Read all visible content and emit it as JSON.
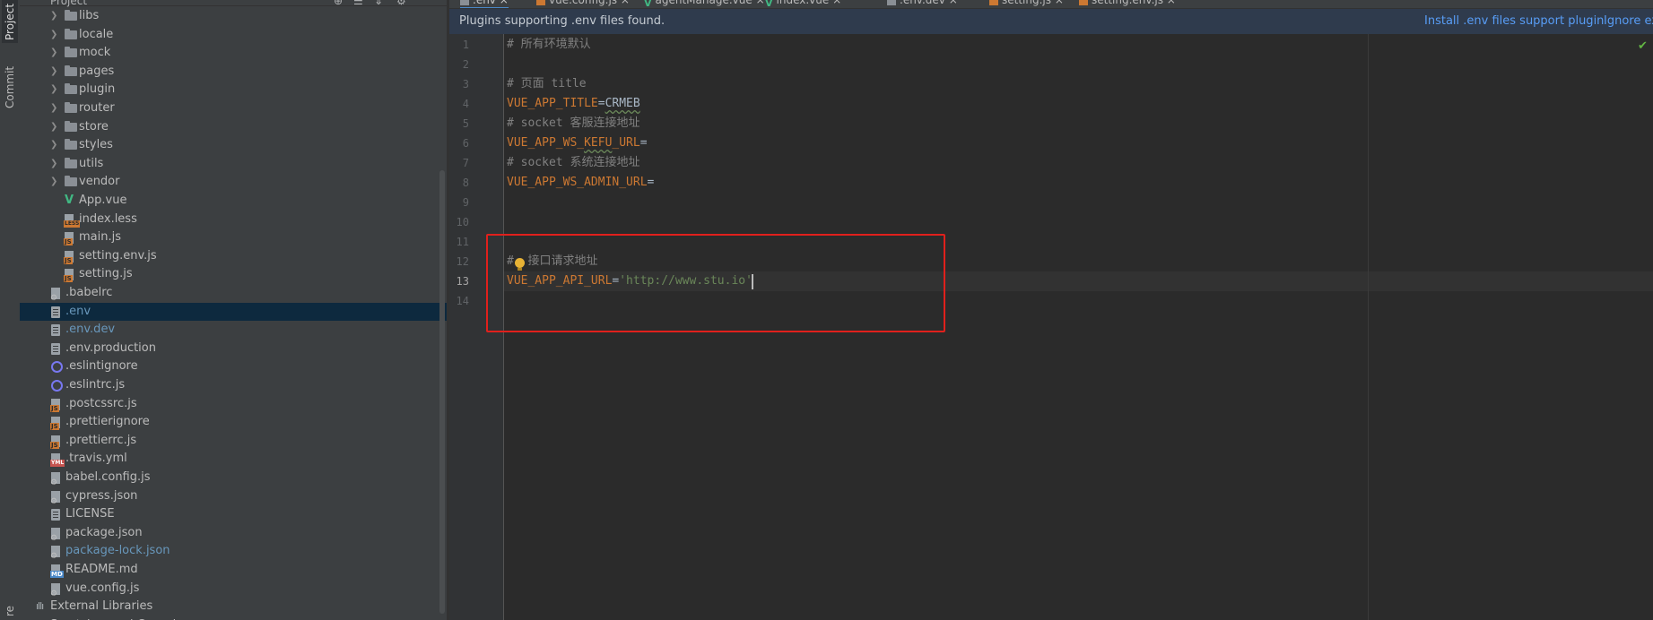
{
  "left_strip": {
    "project_tab": "Project",
    "commit_tab": "Commit",
    "bottom_tab": "re"
  },
  "project_panel": {
    "title": "Project",
    "tree": [
      {
        "label": "libs",
        "type": "folder",
        "depth": 1
      },
      {
        "label": "locale",
        "type": "folder",
        "depth": 1
      },
      {
        "label": "mock",
        "type": "folder",
        "depth": 1
      },
      {
        "label": "pages",
        "type": "folder",
        "depth": 1
      },
      {
        "label": "plugin",
        "type": "folder",
        "depth": 1
      },
      {
        "label": "router",
        "type": "folder",
        "depth": 1
      },
      {
        "label": "store",
        "type": "folder",
        "depth": 1
      },
      {
        "label": "styles",
        "type": "folder",
        "depth": 1
      },
      {
        "label": "utils",
        "type": "folder",
        "depth": 1
      },
      {
        "label": "vendor",
        "type": "folder",
        "depth": 1
      },
      {
        "label": "App.vue",
        "type": "vue",
        "depth": 1
      },
      {
        "label": "index.less",
        "type": "less",
        "depth": 1
      },
      {
        "label": "main.js",
        "type": "js",
        "depth": 1
      },
      {
        "label": "setting.env.js",
        "type": "js",
        "depth": 1
      },
      {
        "label": "setting.js",
        "type": "js",
        "depth": 1
      },
      {
        "label": ".babelrc",
        "type": "gear",
        "depth": 0
      },
      {
        "label": ".env",
        "type": "file",
        "depth": 0,
        "selected": true,
        "new": true
      },
      {
        "label": ".env.dev",
        "type": "file",
        "depth": 0,
        "new": true
      },
      {
        "label": ".env.production",
        "type": "file",
        "depth": 0
      },
      {
        "label": ".eslintignore",
        "type": "ring",
        "depth": 0
      },
      {
        "label": ".eslintrc.js",
        "type": "ring",
        "depth": 0
      },
      {
        "label": ".postcssrc.js",
        "type": "js",
        "depth": 0
      },
      {
        "label": ".prettierignore",
        "type": "js",
        "depth": 0
      },
      {
        "label": ".prettierrc.js",
        "type": "js",
        "depth": 0
      },
      {
        "label": ".travis.yml",
        "type": "yml",
        "depth": 0
      },
      {
        "label": "babel.config.js",
        "type": "gear",
        "depth": 0
      },
      {
        "label": "cypress.json",
        "type": "gear",
        "depth": 0
      },
      {
        "label": "LICENSE",
        "type": "file",
        "depth": 0
      },
      {
        "label": "package.json",
        "type": "gear",
        "depth": 0
      },
      {
        "label": "package-lock.json",
        "type": "gear",
        "depth": 0,
        "new": true
      },
      {
        "label": "README.md",
        "type": "md",
        "depth": 0
      },
      {
        "label": "vue.config.js",
        "type": "gear",
        "depth": 0
      },
      {
        "label": "External Libraries",
        "type": "lib",
        "depth": -1
      },
      {
        "label": "Scratches and Consoles",
        "type": "scratch",
        "depth": -1
      }
    ]
  },
  "tabs": [
    {
      "label": ".env",
      "type": "env",
      "active": true
    },
    {
      "label": "vue.config.js",
      "type": "js"
    },
    {
      "label": "agentManage.vue",
      "type": "vue"
    },
    {
      "label": "index.vue",
      "type": "vue"
    },
    {
      "label": ".env.dev",
      "type": "env"
    },
    {
      "label": "setting.js",
      "type": "js"
    },
    {
      "label": "setting.env.js",
      "type": "js"
    }
  ],
  "notice": {
    "text": "Plugins supporting .env files found.",
    "install_link": "Install .env files support plugin",
    "ignore_link": "Ignore ex"
  },
  "editor": {
    "current_line": 13,
    "lines": [
      {
        "n": "1",
        "parts": [
          {
            "t": "# 所有环境默认",
            "c": "comment"
          }
        ]
      },
      {
        "n": "2",
        "parts": []
      },
      {
        "n": "3",
        "parts": [
          {
            "t": "# 页面 title",
            "c": "comment"
          }
        ]
      },
      {
        "n": "4",
        "parts": [
          {
            "t": "VUE_APP_TITLE",
            "c": "key"
          },
          {
            "t": "=",
            "c": "op"
          },
          {
            "t": "CRMEB",
            "c": "val typo"
          }
        ]
      },
      {
        "n": "5",
        "parts": [
          {
            "t": "# socket 客服连接地址",
            "c": "comment"
          }
        ]
      },
      {
        "n": "6",
        "parts": [
          {
            "t": "VUE_APP_WS_",
            "c": "key"
          },
          {
            "t": "KEFU",
            "c": "key typo"
          },
          {
            "t": "_URL",
            "c": "key"
          },
          {
            "t": "=",
            "c": "op"
          }
        ]
      },
      {
        "n": "7",
        "parts": [
          {
            "t": "# socket 系统连接地址",
            "c": "comment"
          }
        ]
      },
      {
        "n": "8",
        "parts": [
          {
            "t": "VUE_APP_WS_ADMIN_URL",
            "c": "key"
          },
          {
            "t": "=",
            "c": "op"
          }
        ]
      },
      {
        "n": "9",
        "parts": []
      },
      {
        "n": "10",
        "parts": []
      },
      {
        "n": "11",
        "parts": []
      },
      {
        "n": "12",
        "parts": [
          {
            "t": "#  接口请求地址",
            "c": "comment"
          }
        ]
      },
      {
        "n": "13",
        "parts": [
          {
            "t": "VUE_APP_API_URL",
            "c": "key"
          },
          {
            "t": "=",
            "c": "op"
          },
          {
            "t": "'http://www.stu.io'",
            "c": "str"
          }
        ]
      },
      {
        "n": "14",
        "parts": []
      }
    ]
  },
  "colors": {
    "accent": "#4a88c7",
    "highlight_box": "#e0201c",
    "key": "#cc7832",
    "string": "#6a8759",
    "comment": "#808080"
  }
}
